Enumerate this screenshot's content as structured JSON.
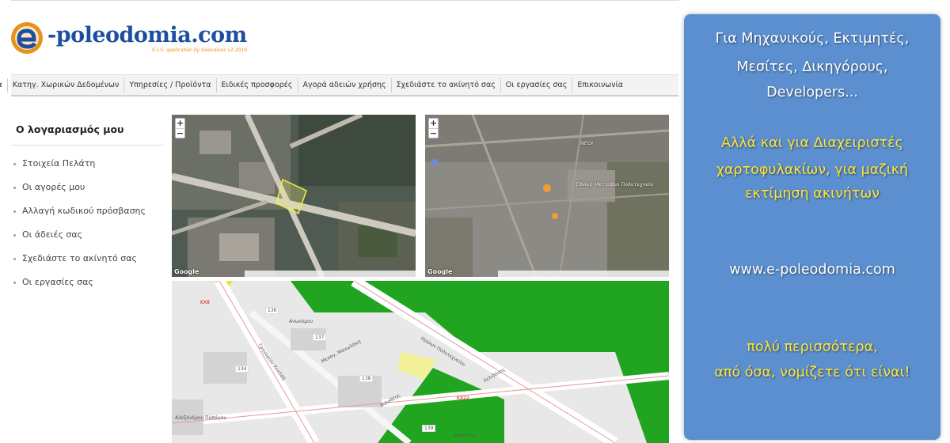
{
  "brand": {
    "name": "-poleodomia.com",
    "tagline": "G.I.S. application by Geovalues v2 2019"
  },
  "nav": {
    "items": [
      "Αρχική σελίδα",
      "Κατηγ. Χωρικών Δεδομένων",
      "Υπηρεσίες / Προϊόντα",
      "Ειδικές προσφορές",
      "Αγορά αδειών χρήσης",
      "Σχεδιάστε το ακίνητό σας",
      "Οι εργασίες σας",
      "Επικοινωνία"
    ]
  },
  "sidebar": {
    "title": "Ο λογαριασμός μου",
    "items": [
      "Στοιχεία Πελάτη",
      "Οι αγορές μου",
      "Αλλαγή κωδικού πρόσβασης",
      "Οι άδειές σας",
      "Σχεδιάστε το ακίνητό σας",
      "Οι εργασίες σας"
    ]
  },
  "maps": {
    "zoom_in": "+",
    "zoom_out": "−",
    "provider": "Google",
    "sat2_labels": [
      "ΝΕΟΙ",
      "Εθνικό Μετσόβιο Πολυτεχνείο"
    ],
    "plan": {
      "blocks": [
        "136",
        "137",
        "134",
        "138",
        "139"
      ],
      "codes": [
        "KX8",
        "KX22"
      ],
      "streets": [
        "Ανωνύμου",
        "Γρηγορίου Κυκλάδ.",
        "Μεσογ. Μανωλάκη",
        "Ηρώων Πολυτεχνείου",
        "Χελιδόνος",
        "Φιλοθέης",
        "Αλεξάνδρου Παπάγου",
        "Χορτιάτη"
      ]
    }
  },
  "promo": {
    "audience": [
      "Για Μηχανικούς, Εκτιμητές,",
      "Μεσίτες, Δικηγόρους,",
      "Developers..."
    ],
    "portfolio": [
      "Αλλά και για Διαχειριστές",
      "χαρτοφυλακίων, για μαζική",
      "εκτίμηση ακινήτων"
    ],
    "url": "www.e-poleodomia.com",
    "closing": [
      "πολύ περισσότερα,",
      "από όσα, νομίζετε ότι είναι!"
    ]
  },
  "colors": {
    "promo_bg": "#5b8fcf",
    "promo_highlight": "#ffe43a",
    "brand_blue": "#1d4f9c",
    "brand_orange": "#e8901c",
    "plan_green": "#21a521"
  }
}
